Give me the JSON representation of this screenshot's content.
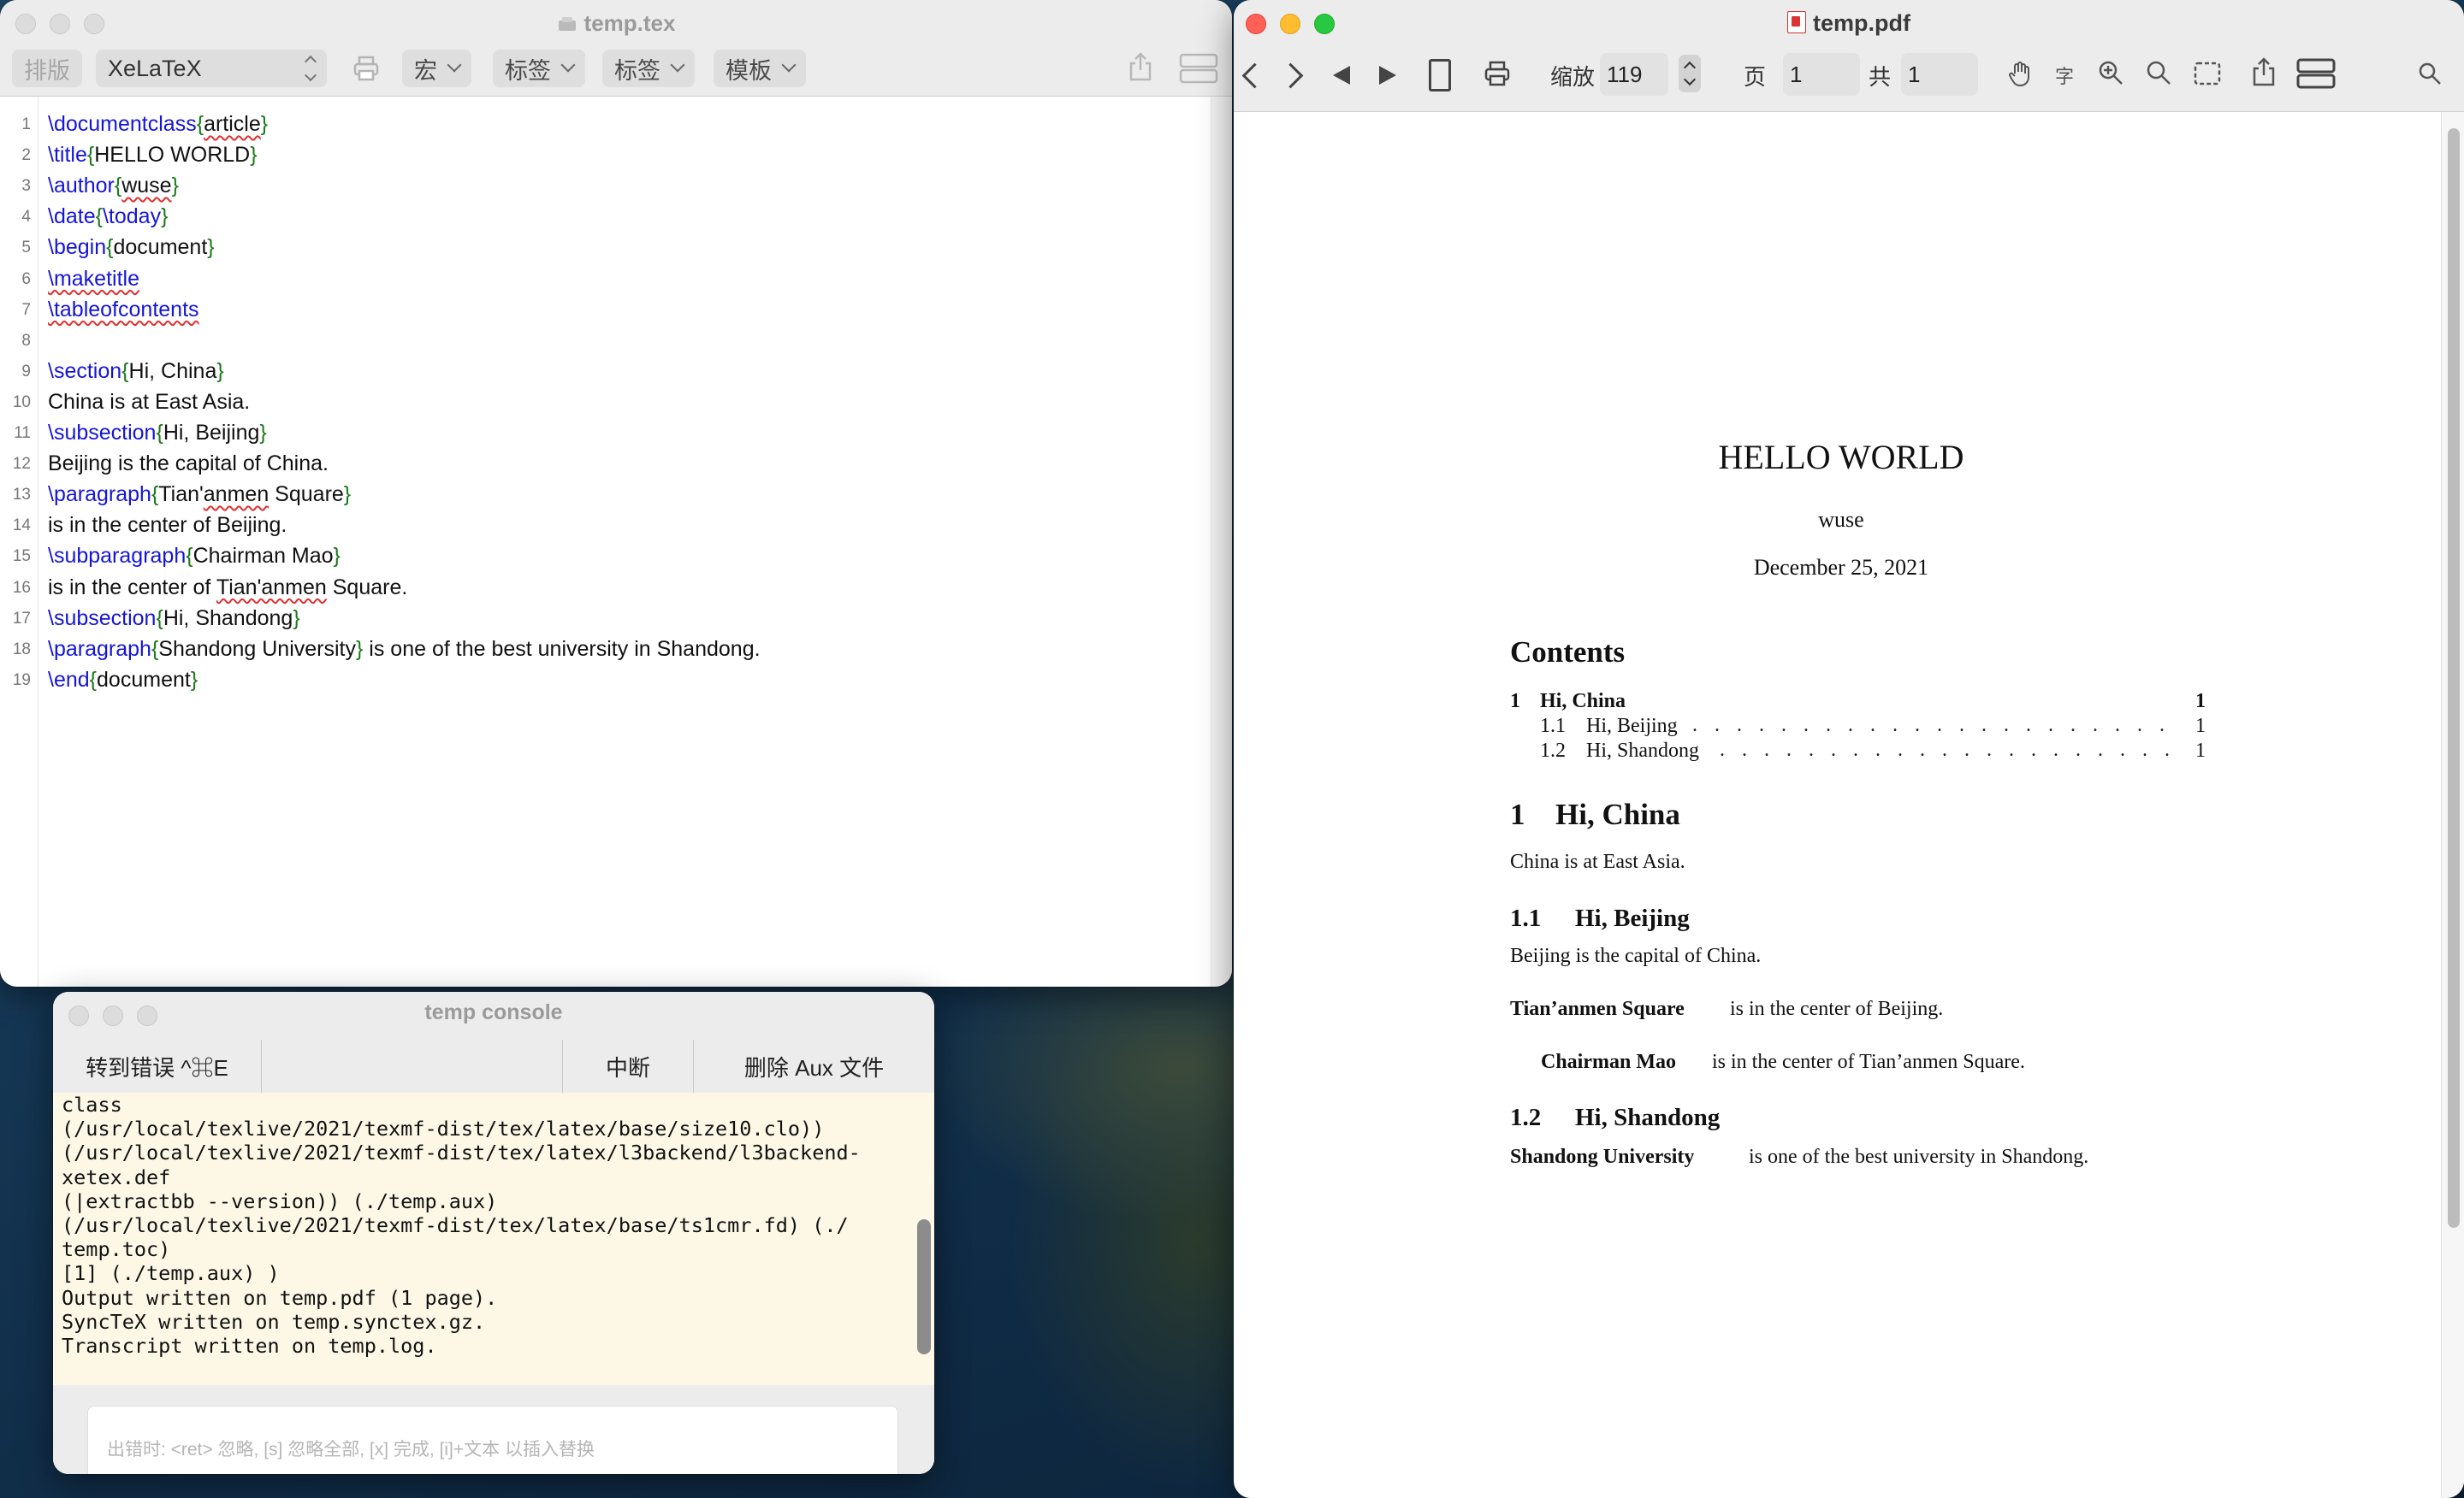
{
  "editor": {
    "title": "temp.tex",
    "toolbar": {
      "typeset": "排版",
      "engine": "XeLaTeX",
      "macro": "宏",
      "tag1": "标签",
      "tag2": "标签",
      "template": "模板"
    },
    "lines": [
      {
        "n": "1",
        "parts": [
          [
            "kw",
            "\\documentclass"
          ],
          [
            "br",
            "{"
          ],
          [
            "sq",
            "article"
          ],
          [
            "br",
            "}"
          ]
        ]
      },
      {
        "n": "2",
        "parts": [
          [
            "kw",
            "\\title"
          ],
          [
            "br",
            "{"
          ],
          [
            "tx",
            "HELLO WORLD"
          ],
          [
            "br",
            "}"
          ]
        ]
      },
      {
        "n": "3",
        "parts": [
          [
            "kw",
            "\\author"
          ],
          [
            "br",
            "{"
          ],
          [
            "sq",
            "wuse"
          ],
          [
            "br",
            "}"
          ]
        ]
      },
      {
        "n": "4",
        "parts": [
          [
            "kw",
            "\\date"
          ],
          [
            "br",
            "{"
          ],
          [
            "kw",
            "\\today"
          ],
          [
            "br",
            "}"
          ]
        ]
      },
      {
        "n": "5",
        "parts": [
          [
            "kw",
            "\\begin"
          ],
          [
            "br",
            "{"
          ],
          [
            "tx",
            "document"
          ],
          [
            "br",
            "}"
          ]
        ]
      },
      {
        "n": "6",
        "parts": [
          [
            "kwsq",
            "\\maketitle"
          ]
        ]
      },
      {
        "n": "7",
        "parts": [
          [
            "kwsq",
            "\\tableofcontents"
          ]
        ]
      },
      {
        "n": "8",
        "parts": []
      },
      {
        "n": "9",
        "parts": [
          [
            "kw",
            "\\section"
          ],
          [
            "br",
            "{"
          ],
          [
            "tx",
            "Hi, China"
          ],
          [
            "br",
            "}"
          ]
        ]
      },
      {
        "n": "10",
        "parts": [
          [
            "tx",
            "China is at East Asia."
          ]
        ]
      },
      {
        "n": "11",
        "parts": [
          [
            "kw",
            "\\subsection"
          ],
          [
            "br",
            "{"
          ],
          [
            "tx",
            "Hi, Beijing"
          ],
          [
            "br",
            "}"
          ]
        ]
      },
      {
        "n": "12",
        "parts": [
          [
            "tx",
            "Beijing is the capital of China."
          ]
        ]
      },
      {
        "n": "13",
        "parts": [
          [
            "kw",
            "\\paragraph"
          ],
          [
            "br",
            "{"
          ],
          [
            "tx",
            "Tian'"
          ],
          [
            "sq",
            "anmen"
          ],
          [
            "tx",
            " Square"
          ],
          [
            "br",
            "}"
          ]
        ]
      },
      {
        "n": "14",
        "parts": [
          [
            "tx",
            "is in the center of Beijing."
          ]
        ]
      },
      {
        "n": "15",
        "parts": [
          [
            "kw",
            "\\subparagraph"
          ],
          [
            "br",
            "{"
          ],
          [
            "tx",
            "Chairman Mao"
          ],
          [
            "br",
            "}"
          ]
        ]
      },
      {
        "n": "16",
        "parts": [
          [
            "tx",
            "is in the center of "
          ],
          [
            "sq",
            "Tian'anmen"
          ],
          [
            "tx",
            " Square."
          ]
        ]
      },
      {
        "n": "17",
        "parts": [
          [
            "kw",
            "\\subsection"
          ],
          [
            "br",
            "{"
          ],
          [
            "tx",
            "Hi, Shandong"
          ],
          [
            "br",
            "}"
          ]
        ]
      },
      {
        "n": "18",
        "parts": [
          [
            "kw",
            "\\paragraph"
          ],
          [
            "br",
            "{"
          ],
          [
            "tx",
            "Shandong University"
          ],
          [
            "br",
            "}"
          ],
          [
            "tx",
            " is one of the best university in Shandong."
          ]
        ]
      },
      {
        "n": "19",
        "parts": [
          [
            "kw",
            "\\end"
          ],
          [
            "br",
            "{"
          ],
          [
            "tx",
            "document"
          ],
          [
            "br",
            "}"
          ]
        ]
      }
    ]
  },
  "console": {
    "title": "temp console",
    "goto_error": "转到错误 ^⌘E",
    "abort": "中断",
    "delete_aux": "删除 Aux 文件",
    "log": [
      "class",
      "(/usr/local/texlive/2021/texmf-dist/tex/latex/base/size10.clo))",
      "(/usr/local/texlive/2021/texmf-dist/tex/latex/l3backend/l3backend-",
      "xetex.def",
      "(|extractbb --version)) (./temp.aux)",
      "(/usr/local/texlive/2021/texmf-dist/tex/latex/base/ts1cmr.fd) (./",
      "temp.toc)",
      "[1] (./temp.aux) )",
      "Output written on temp.pdf (1 page).",
      "SyncTeX written on temp.synctex.gz.",
      "Transcript written on temp.log."
    ],
    "input_placeholder": "出错时: <ret> 忽略, [s] 忽略全部, [x] 完成, [i]+文本 以插入替换"
  },
  "pdf": {
    "title": "temp.pdf",
    "zoom_label": "缩放",
    "zoom_value": "119",
    "page_label": "页",
    "page_value": "1",
    "total_label": "共",
    "total_value": "1",
    "text_tool": "字",
    "doc": {
      "title": "HELLO WORLD",
      "author": "wuse",
      "date": "December 25, 2021",
      "contents_heading": "Contents",
      "toc": [
        {
          "num": "1",
          "label": "Hi, China",
          "page": "1"
        },
        {
          "num": "1.1",
          "label": "Hi, Beijing",
          "page": "1"
        },
        {
          "num": "1.2",
          "label": "Hi, Shandong",
          "page": "1"
        }
      ],
      "s1_num": "1",
      "s1_title": "Hi, China",
      "s1_text": "China is at East Asia.",
      "s11_num": "1.1",
      "s11_title": "Hi, Beijing",
      "s11_text": "Beijing is the capital of China.",
      "p1_title": "Tian’anmen Square",
      "p1_text": "is in the center of Beijing.",
      "sp_title": "Chairman Mao",
      "sp_text": "is in the center of Tian’anmen Square.",
      "s12_num": "1.2",
      "s12_title": "Hi, Shandong",
      "p2_title": "Shandong University",
      "p2_text": "is one of the best university in Shandong."
    }
  }
}
